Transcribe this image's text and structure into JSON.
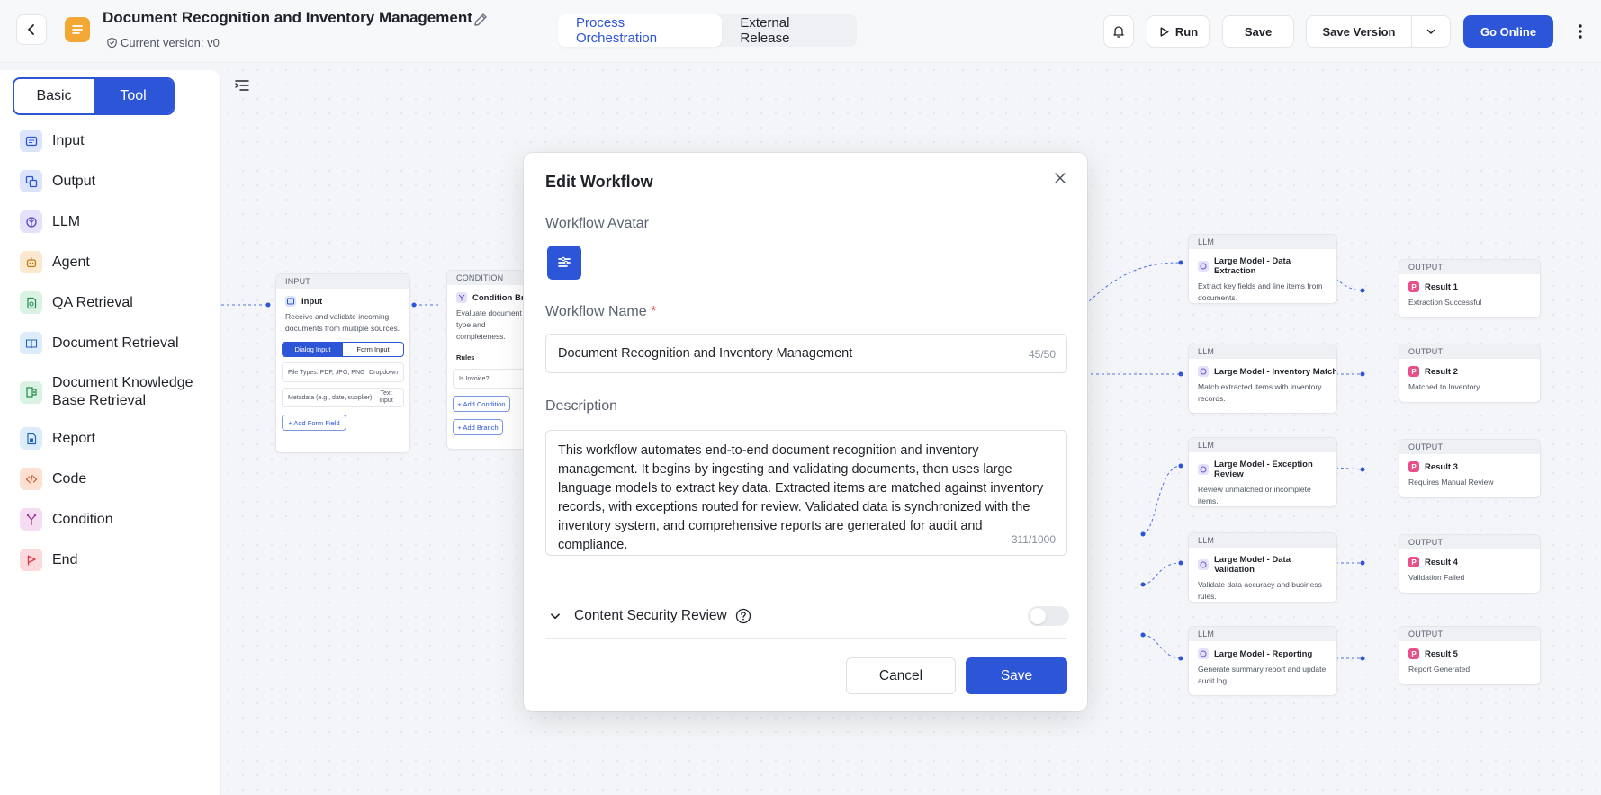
{
  "header": {
    "workflow_title": "Document Recognition and Inventory Management",
    "version_label": "Current version: v0",
    "tabs": [
      {
        "label": "Process Orchestration"
      },
      {
        "label": "External Release"
      }
    ],
    "run_label": "Run",
    "save_label": "Save",
    "save_version_label": "Save Version",
    "go_online_label": "Go Online"
  },
  "sidebar": {
    "segment": {
      "basic": "Basic",
      "tool": "Tool"
    },
    "items": [
      {
        "label": "Input"
      },
      {
        "label": "Output"
      },
      {
        "label": "LLM"
      },
      {
        "label": "Agent"
      },
      {
        "label": "QA Retrieval"
      },
      {
        "label": "Document Retrieval"
      },
      {
        "label": "Document Knowledge Base Retrieval"
      },
      {
        "label": "Report"
      },
      {
        "label": "Code"
      },
      {
        "label": "Condition"
      },
      {
        "label": "End"
      }
    ]
  },
  "canvas": {
    "input_node": {
      "header": "INPUT",
      "title": "Input",
      "desc": "Receive and validate incoming documents from multiple sources.",
      "tab_dialog": "Dialog Input",
      "tab_form": "Form Input",
      "row1_label": "File Types: PDF, JPG, PNG",
      "row1_type": "Dropdown",
      "row2_label": "Metadata (e.g., date, supplier)",
      "row2_type": "Text Input",
      "add_field": "+ Add Form Field"
    },
    "condition_node": {
      "header": "CONDITION",
      "title": "Condition Branch",
      "desc": "Evaluate document type and completeness.",
      "rules_label": "Rules",
      "rule1": "Is Invoice?",
      "add_condition": "+ Add Condition",
      "add_branch": "+ Add Branch"
    },
    "llm_nodes": [
      {
        "header": "LLM",
        "title": "Large Model - Data Extraction",
        "desc": "Extract key fields and line items from documents."
      },
      {
        "header": "LLM",
        "title": "Large Model - Inventory Matching",
        "desc": "Match extracted items with inventory records."
      },
      {
        "header": "LLM",
        "title": "Large Model - Exception Review",
        "desc": "Review unmatched or incomplete items."
      },
      {
        "header": "LLM",
        "title": "Large Model - Data Validation",
        "desc": "Validate data accuracy and business rules."
      },
      {
        "header": "LLM",
        "title": "Large Model - Reporting",
        "desc": "Generate summary report and update audit log."
      }
    ],
    "output_nodes": [
      {
        "header": "OUTPUT",
        "title": "Result 1",
        "desc": "Extraction Successful"
      },
      {
        "header": "OUTPUT",
        "title": "Result 2",
        "desc": "Matched to Inventory"
      },
      {
        "header": "OUTPUT",
        "title": "Result 3",
        "desc": "Requires Manual Review"
      },
      {
        "header": "OUTPUT",
        "title": "Result 4",
        "desc": "Validation Failed"
      },
      {
        "header": "OUTPUT",
        "title": "Result 5",
        "desc": "Report Generated"
      }
    ]
  },
  "modal": {
    "title": "Edit Workflow",
    "avatar_label": "Workflow Avatar",
    "name_label": "Workflow Name",
    "name_required": "*",
    "name_value": "Document Recognition and Inventory Management",
    "name_count": "45/50",
    "description_label": "Description",
    "description_value": "This workflow automates end-to-end document recognition and inventory management. It begins by ingesting and validating documents, then uses large language models to extract key data. Extracted items are matched against inventory records, with exceptions routed for review. Validated data is synchronized with the inventory system, and comprehensive reports are generated for audit and compliance.",
    "description_count": "311/1000",
    "content_security_label": "Content Security Review",
    "content_security_enabled": false,
    "cancel_label": "Cancel",
    "save_label": "Save"
  },
  "colors": {
    "accent": "#2d55d8",
    "logo": "#f3a735",
    "output_icon": "#e8508a"
  }
}
